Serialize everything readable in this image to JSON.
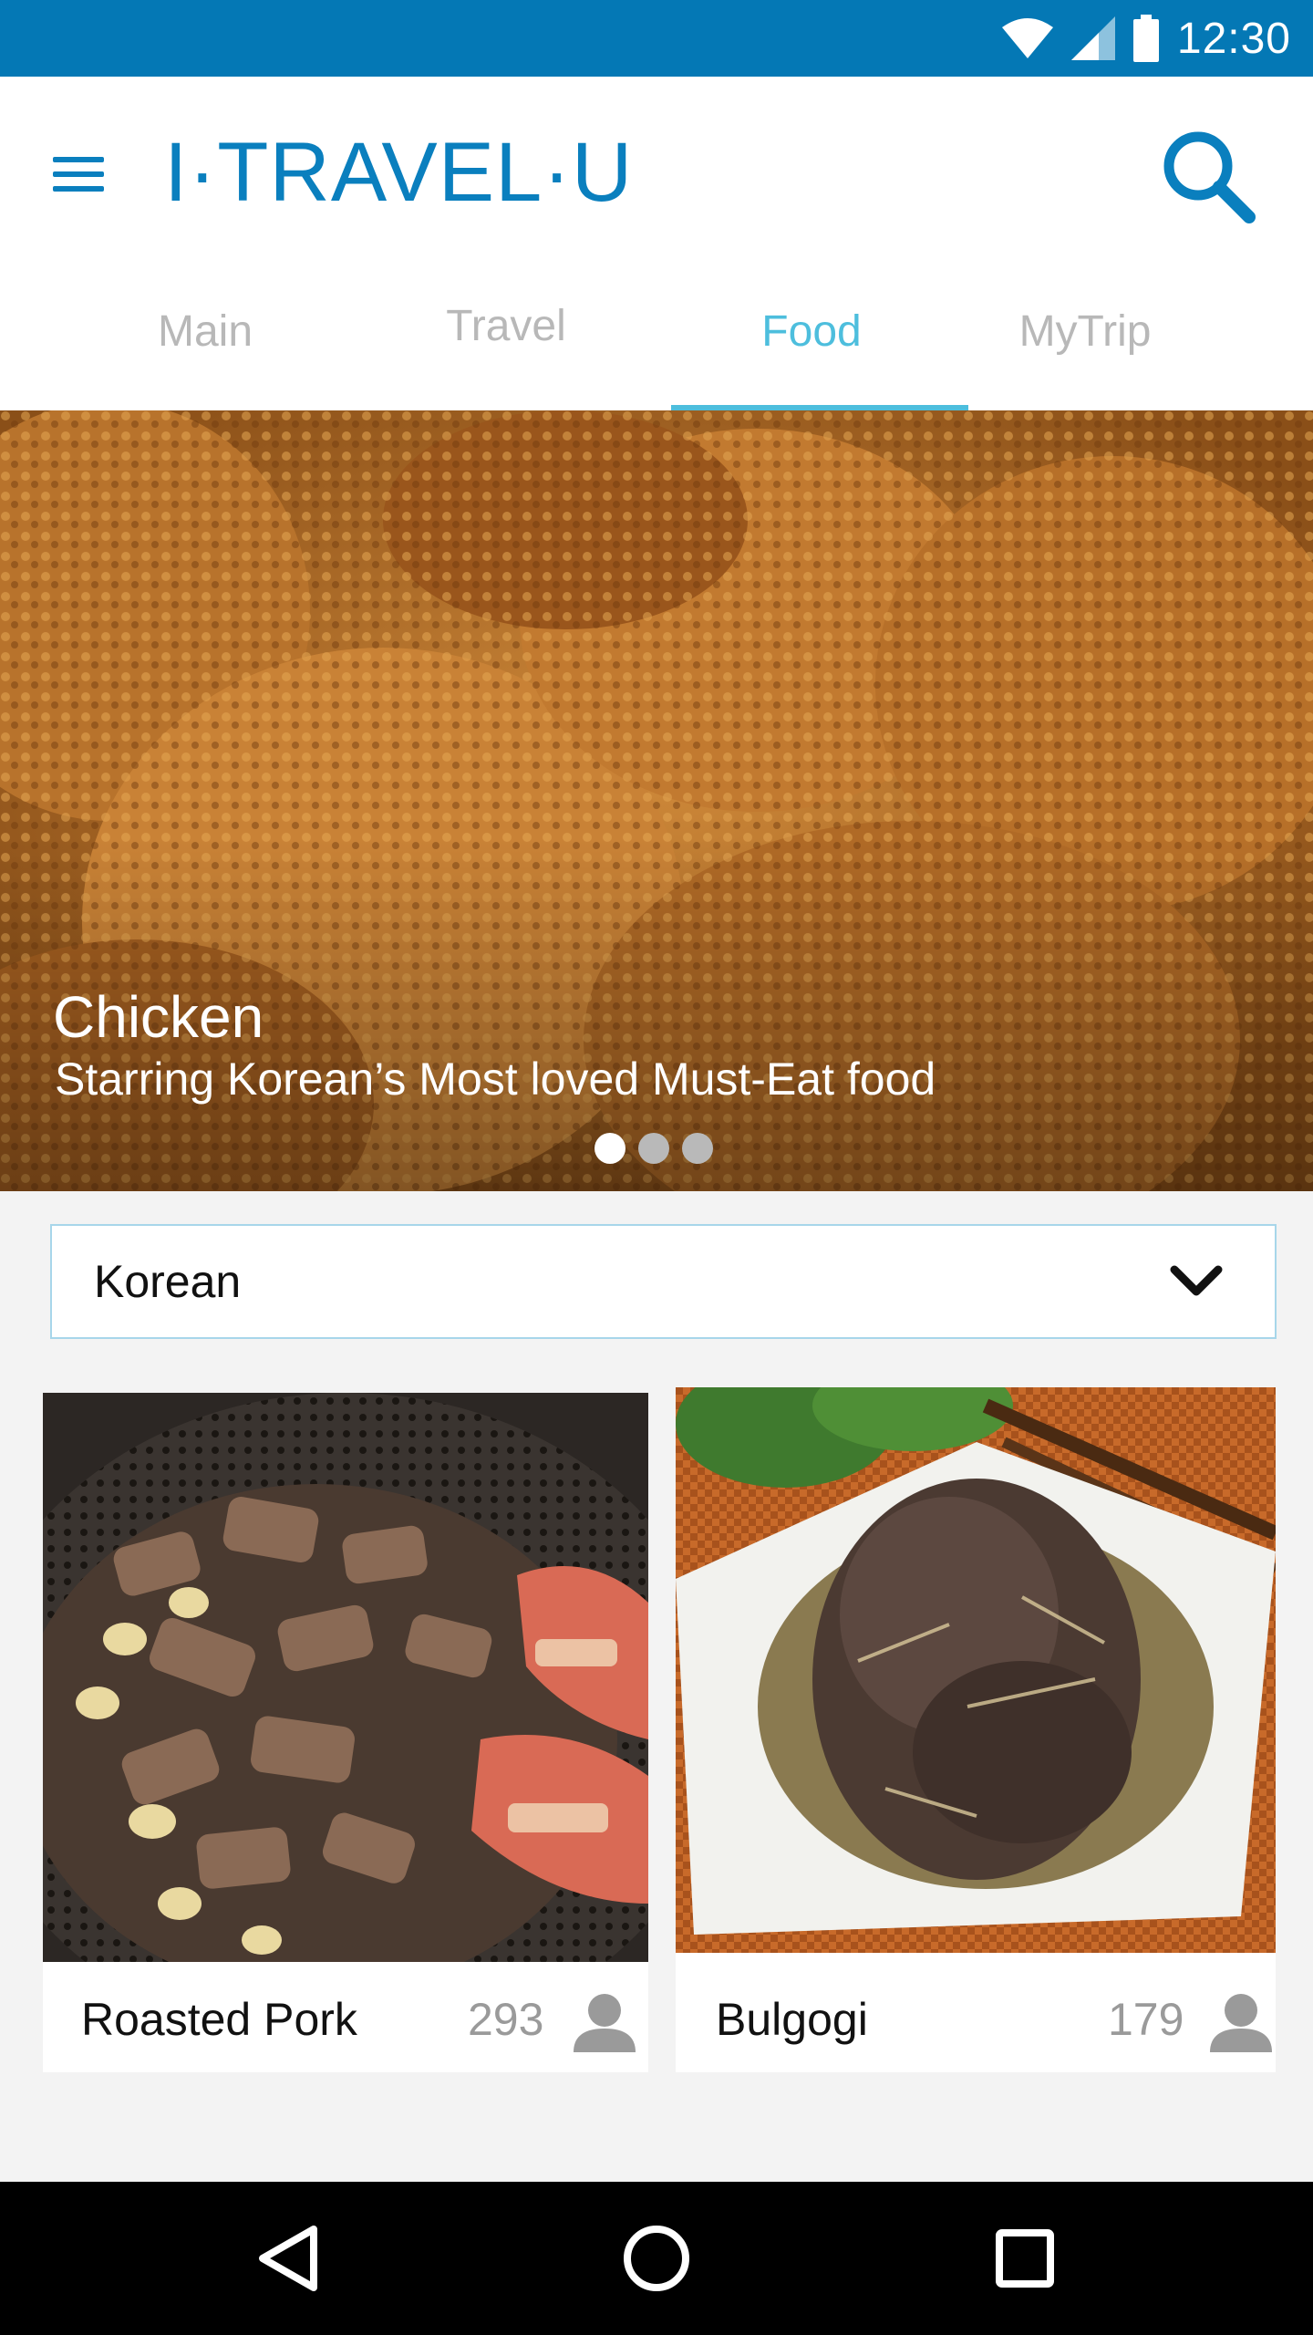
{
  "status_bar": {
    "time": "12:30",
    "icons": [
      "wifi-icon",
      "signal-icon",
      "battery-icon"
    ],
    "background": "#0478b5"
  },
  "app_bar": {
    "logo": "I·TRAVEL·U",
    "brand_color": "#0a7fbe",
    "icons": [
      "menu-icon",
      "search-icon"
    ]
  },
  "tabs": {
    "items": [
      {
        "label": "Main",
        "active": false
      },
      {
        "label": "Travel",
        "active": false
      },
      {
        "label": "Food",
        "active": true
      },
      {
        "label": "MyTrip",
        "active": false
      }
    ],
    "active_color": "#4dbedd",
    "inactive_color": "#b8b8b8"
  },
  "hero": {
    "title": "Chicken",
    "subtitle": "Starring Korean’s Most loved Must-Eat food",
    "slide_count": 3,
    "active_slide": 1
  },
  "filter": {
    "selected": "Korean",
    "icon": "chevron-down-icon"
  },
  "cards": [
    {
      "name": "Roasted Pork",
      "count": "293",
      "icon": "person-icon"
    },
    {
      "name": "Bulgogi",
      "count": "179",
      "icon": "person-icon"
    }
  ],
  "nav_bar": {
    "icons": [
      "back-icon",
      "home-icon",
      "recents-icon"
    ]
  }
}
